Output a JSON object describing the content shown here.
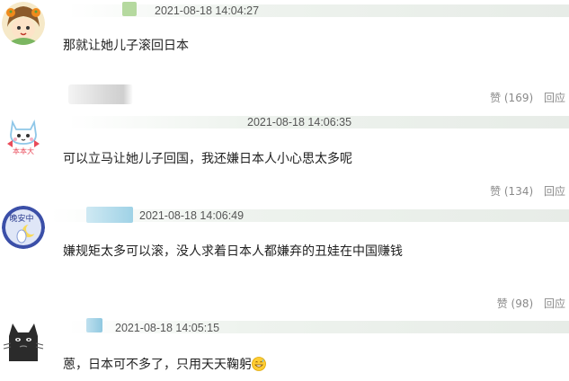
{
  "comments": [
    {
      "timestamp": "2021-08-18 14:04:27",
      "content": "那就让她儿子滚回日本",
      "like_label": "赞 (169)",
      "reply_label": "回应"
    },
    {
      "timestamp": "2021-08-18 14:06:35",
      "content": "可以立马让她儿子回国，我还嫌日本人小心思太多呢",
      "like_label": "赞 (134)",
      "reply_label": "回应"
    },
    {
      "timestamp": "2021-08-18 14:06:49",
      "content": "嫌规矩太多可以滚，没人求着日本人都嫌弃的丑娃在中国赚钱",
      "like_label": "赞 (98)",
      "reply_label": "回应"
    },
    {
      "timestamp": "2021-08-18 14:05:15",
      "content": "蒽，日本可不多了，只用天天鞠躬",
      "emoji": "grinning-sweat-emoji",
      "like_label": "",
      "reply_label": ""
    }
  ],
  "avatar_texts": {
    "cat_avatar": "本本大",
    "moon_avatar": "晚安中"
  },
  "colors": {
    "header_bar": "#e7ece7",
    "action_text": "#8a8a8a",
    "timestamp_text": "#555555"
  }
}
